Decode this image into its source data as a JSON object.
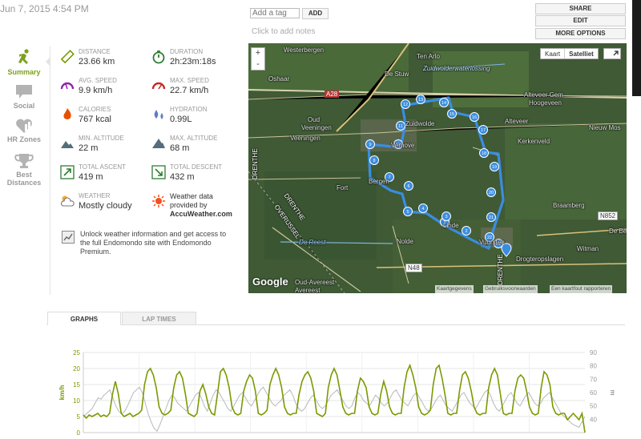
{
  "header": {
    "date": "Jun 7, 2015 4:54 PM",
    "tag_placeholder": "Add a tag",
    "add_label": "ADD",
    "notes_label": "Click to add notes",
    "share_label": "SHARE",
    "edit_label": "EDIT",
    "more_options_label": "MORE OPTIONS"
  },
  "sidebar": {
    "items": [
      {
        "label": "Summary",
        "icon": "runner-icon",
        "active": true
      },
      {
        "label": "Social",
        "icon": "speech-bubble-icon"
      },
      {
        "label": "HR Zones",
        "icon": "heart-chart-icon"
      },
      {
        "label": "Best Distances",
        "icon": "trophy-icon"
      }
    ]
  },
  "stats": {
    "distance": {
      "label": "DISTANCE",
      "value": "23.66 km"
    },
    "duration": {
      "label": "DURATION",
      "value": "2h:23m:18s"
    },
    "avg_speed": {
      "label": "AVG. SPEED",
      "value": "9.9 km/h"
    },
    "max_speed": {
      "label": "MAX. SPEED",
      "value": "22.7 km/h"
    },
    "calories": {
      "label": "CALORIES",
      "value": "767 kcal"
    },
    "hydration": {
      "label": "HYDRATION",
      "value": "0.99L"
    },
    "min_altitude": {
      "label": "MIN. ALTITUDE",
      "value": "22 m"
    },
    "max_altitude": {
      "label": "MAX. ALTITUDE",
      "value": "68 m"
    },
    "total_ascent": {
      "label": "TOTAL ASCENT",
      "value": "419 m"
    },
    "total_descent": {
      "label": "TOTAL DESCENT",
      "value": "432 m"
    },
    "weather": {
      "label": "WEATHER",
      "value": "Mostly cloudy"
    },
    "weather_provider": {
      "line1": "Weather data",
      "line2": "provided by",
      "line3": "AccuWeather.com"
    },
    "unlock_text": "Unlock weather information and get access to the full Endomondo site with Endomondo Premium."
  },
  "map": {
    "zoom_in": "+",
    "zoom_out": "-",
    "type_map": "Kaart",
    "type_satellite": "Satelliet",
    "google_logo": "Google",
    "footer_links": [
      "Kaartgegevens",
      "Gebruiksvoorwaarden",
      "Een kaartfout rapporteren"
    ],
    "labels": {
      "westerbergen": "Westerbergen",
      "tenarlo": "Ten Arlo",
      "zuidwolder": "Zuidwolderwaterlossing",
      "oshaar": "Oshaar",
      "destuw": "De Stuw",
      "a28": "A28",
      "alteveer_gem": "Alteveer Gem",
      "hoogeveen": "Hoogeveen",
      "alteveer": "Alteveer",
      "nieuwmos": "Nieuw Mos",
      "oudveeningen": "Oud",
      "oudveeningen2": "Veeningen",
      "veeningen": "Veeningen",
      "kerkenveld": "Kerkenveld",
      "drenthe1": "DRENTHE",
      "fort": "Fort",
      "braamberg": "Braamberg",
      "n852": "N852",
      "drenthe2": "DRENTHE",
      "overijssel": "OVERIJSSEL",
      "debe": "De Be",
      "dereest": "De Reest",
      "nolde": "Nolde",
      "witman": "Witman",
      "n48": "N48",
      "drogteropslagen": "Drogteropslagen",
      "oudavereest": "Oud-Avereest",
      "avereest": "Avereest",
      "zuidwolde": "Zuidwolde",
      "linde": "Linde",
      "vuurstee": "Vuurstee",
      "bergen": "Bergen",
      "verhove": "Verhove",
      "drenthe3": "DRENTHE"
    },
    "markers": [
      "1",
      "2",
      "3",
      "4",
      "5",
      "6",
      "7",
      "8",
      "9",
      "10",
      "11",
      "12",
      "13",
      "14",
      "15",
      "16",
      "17",
      "18",
      "19",
      "20",
      "21",
      "22",
      "23"
    ]
  },
  "tabs": {
    "graphs": "GRAPHS",
    "laps": "LAP TIMES"
  },
  "chart_data": {
    "type": "line",
    "title": "",
    "xlabel": "",
    "ylabel_left": "km/h",
    "ylabel_right": "m",
    "ylim_left": [
      0,
      25
    ],
    "yticks_left": [
      "25",
      "20",
      "15",
      "10",
      "5",
      "0"
    ],
    "ylim_right": [
      30,
      90
    ],
    "yticks_right": [
      "90",
      "80",
      "70",
      "60",
      "50",
      "40"
    ],
    "colors": {
      "speed": "#7a9a01",
      "altitude": "#b8b8b8"
    },
    "series": [
      {
        "axis": "left",
        "values": [
          5.5,
          4.5,
          5.5,
          5,
          5.5,
          6,
          5,
          5.5,
          5,
          6,
          12,
          16,
          12,
          6,
          5,
          5.5,
          6,
          5,
          5.5,
          6,
          7,
          15,
          19,
          20,
          18,
          14,
          8,
          6,
          5.5,
          6,
          7,
          14,
          18,
          19,
          17,
          12,
          6,
          5.5,
          5,
          6,
          13,
          15,
          12,
          8,
          6,
          5.5,
          12,
          19,
          20,
          18,
          14,
          8,
          6,
          5.5,
          6,
          13,
          16,
          18,
          17,
          13,
          6,
          5.5,
          6,
          7,
          15,
          18,
          20,
          18,
          14,
          8,
          6,
          5.5,
          6,
          6,
          12,
          16,
          18,
          19,
          17,
          13,
          6,
          5.5,
          5,
          6,
          14,
          18,
          20,
          18,
          13,
          8,
          6,
          5.5,
          6,
          6,
          13,
          17,
          16,
          14,
          8,
          6,
          5.5,
          6,
          12,
          16,
          13,
          8,
          6,
          5.5,
          6,
          6,
          14,
          19,
          21,
          18,
          14,
          8,
          6,
          5.5,
          6,
          7,
          15,
          20,
          21,
          17,
          12,
          6,
          5.5,
          6,
          6,
          13,
          18,
          19,
          17,
          13,
          8,
          6,
          5.5,
          6,
          6,
          14,
          18,
          20,
          18,
          12,
          6,
          5.5,
          6,
          6,
          13,
          17,
          18,
          17,
          13,
          8,
          6,
          5.5,
          6,
          14,
          19,
          18,
          15,
          8,
          6,
          5.5,
          6,
          6,
          4,
          5,
          6,
          5,
          4,
          6,
          0
        ]
      },
      {
        "axis": "right",
        "values": [
          42,
          44,
          46,
          48,
          52,
          56,
          55,
          58,
          60,
          62,
          56,
          50,
          46,
          44,
          46,
          50,
          55,
          60,
          62,
          64,
          60,
          52,
          44,
          38,
          33,
          31,
          36,
          42,
          48,
          54,
          58,
          56,
          52,
          50,
          48,
          46,
          50,
          54,
          58,
          60,
          56,
          50,
          46,
          52,
          58,
          62,
          60,
          56,
          52,
          48,
          46,
          50,
          54,
          58,
          60,
          56,
          52,
          50,
          54,
          58,
          62,
          64,
          60,
          56,
          52,
          50,
          52,
          54,
          58,
          60,
          62,
          58,
          52,
          48,
          46,
          48,
          52,
          56,
          58,
          54,
          50,
          48,
          50,
          54,
          58,
          60,
          62,
          58,
          54,
          50,
          48,
          50,
          56,
          60,
          58,
          54,
          52,
          50,
          54,
          58,
          56,
          52,
          50,
          52,
          56,
          60,
          62,
          58,
          54,
          52,
          50,
          54,
          58,
          60,
          56,
          52,
          48,
          46,
          48,
          52,
          56,
          58,
          54,
          50,
          48,
          46,
          50,
          54,
          58,
          60,
          56,
          52,
          50,
          48,
          52,
          56,
          60,
          62,
          58,
          52,
          48,
          46,
          50,
          54,
          58,
          60,
          56,
          52,
          50,
          54,
          58,
          60,
          56,
          52,
          50,
          52,
          56,
          58,
          60,
          56,
          52,
          48,
          44,
          42,
          40,
          38,
          36,
          35,
          34,
          38,
          42
        ]
      }
    ]
  }
}
